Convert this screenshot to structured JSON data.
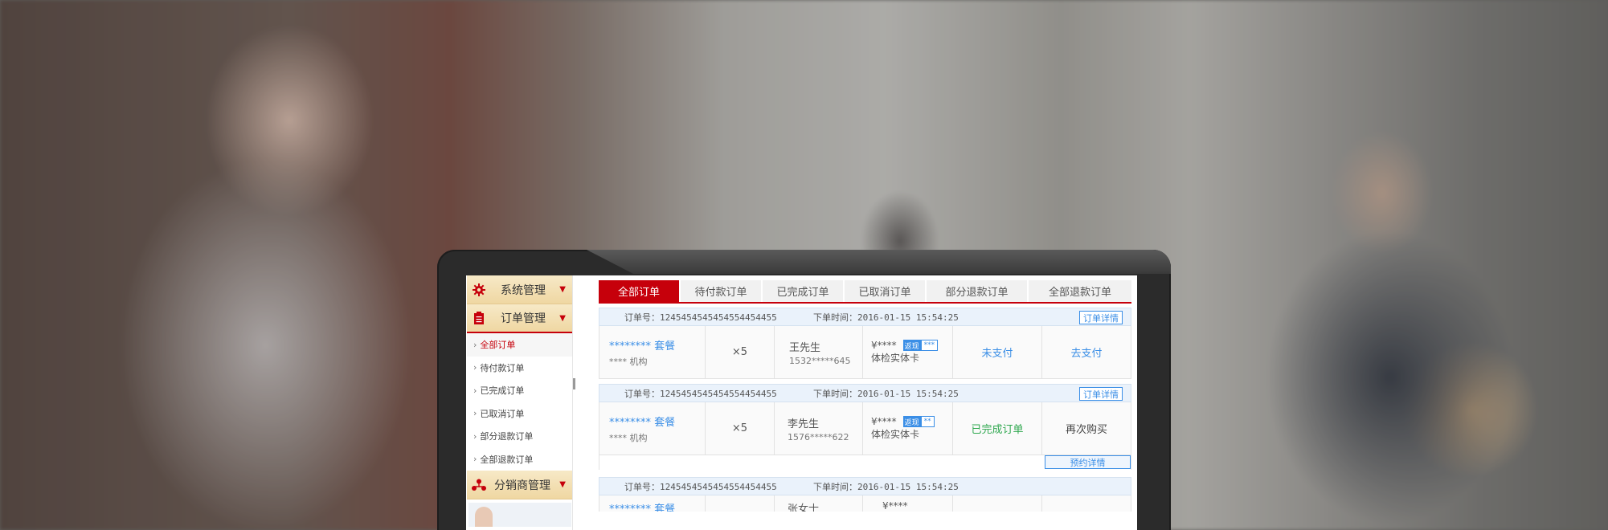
{
  "sidebar": {
    "groups": [
      {
        "label": "系统管理",
        "icon": "gear-icon"
      },
      {
        "label": "订单管理",
        "icon": "clipboard-icon"
      },
      {
        "label": "分销商管理",
        "icon": "network-icon"
      }
    ],
    "order_items": [
      "全部订单",
      "待付款订单",
      "已完成订单",
      "已取消订单",
      "部分退款订单",
      "全部退款订单"
    ]
  },
  "tabs": [
    "全部订单",
    "待付款订单",
    "已完成订单",
    "已取消订单",
    "部分退款订单",
    "全部退款订单"
  ],
  "colors": {
    "accent": "#c6000b",
    "link": "#3a8ee6",
    "success": "#2fa84f"
  },
  "orders": [
    {
      "order_no": "订单号：1245454545454554454455",
      "time": "下单时间：2016-01-15  15:54:25",
      "detail_label": "订单详情",
      "package": "******** 套餐",
      "org": "**** 机构",
      "qty": "×5",
      "name": "王先生",
      "phone": "1532*****645",
      "price": "¥****",
      "tag1": "返现",
      "tag2": "***",
      "card": "体检实体卡",
      "status": "未支付",
      "action": "去支付"
    },
    {
      "order_no": "订单号：1245454545454554454455",
      "time": "下单时间：2016-01-15  15:54:25",
      "detail_label": "订单详情",
      "package": "******** 套餐",
      "org": "**** 机构",
      "qty": "×5",
      "name": "李先生",
      "phone": "1576*****622",
      "price": "¥****",
      "tag1": "返现",
      "tag2": "**",
      "card": "体检实体卡",
      "status": "已完成订单",
      "action": "再次购买",
      "reserve_label": "预约详情"
    },
    {
      "order_no": "订单号：1245454545454554454455",
      "time": "下单时间：2016-01-15  15:54:25",
      "package": "******** 套餐",
      "name": "张女士",
      "price": "¥****"
    }
  ]
}
